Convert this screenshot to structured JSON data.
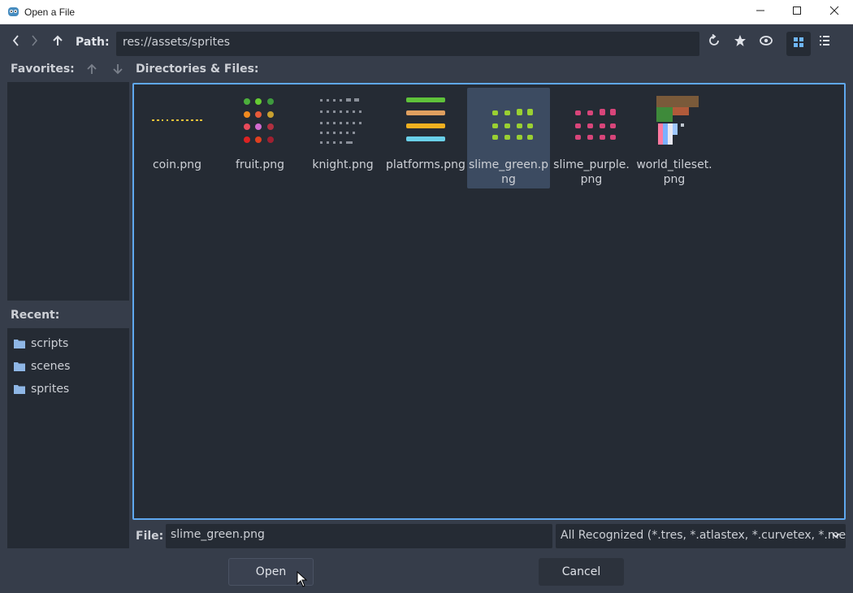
{
  "window": {
    "title": "Open a File",
    "icon": "godot-icon",
    "controls": [
      "minimize-icon",
      "maximize-icon",
      "close-icon"
    ]
  },
  "toolbar": {
    "path_label": "Path:",
    "path_value": "res://assets/sprites",
    "icons": [
      "back-icon",
      "forward-icon",
      "up-icon",
      "refresh-icon",
      "favorite-icon",
      "show-hidden-icon",
      "grid-view-icon",
      "list-view-icon"
    ]
  },
  "favorites": {
    "label": "Favorites:",
    "icons": [
      "move-up-icon",
      "move-down-icon"
    ]
  },
  "directories": {
    "label": "Directories & Files:",
    "files": [
      {
        "name": "coin.png",
        "selected": false
      },
      {
        "name": "fruit.png",
        "selected": false
      },
      {
        "name": "knight.png",
        "selected": false
      },
      {
        "name": "platforms.png",
        "selected": false
      },
      {
        "name": "slime_green.png",
        "selected": true
      },
      {
        "name": "slime_purple.png",
        "selected": false
      },
      {
        "name": "world_tileset.png",
        "selected": false
      }
    ]
  },
  "recent": {
    "label": "Recent:",
    "items": [
      "scripts",
      "scenes",
      "sprites"
    ]
  },
  "bottom": {
    "file_label": "File:",
    "file_value": "slime_green.png",
    "filter_value": "All Recognized (*.tres, *.atlastex, *.curvetex, *.me",
    "open_label": "Open",
    "cancel_label": "Cancel"
  },
  "colors": {
    "background": "#363d4a",
    "panel": "#252b34",
    "accent": "#5fa8ef",
    "selection": "#3c4b61"
  }
}
